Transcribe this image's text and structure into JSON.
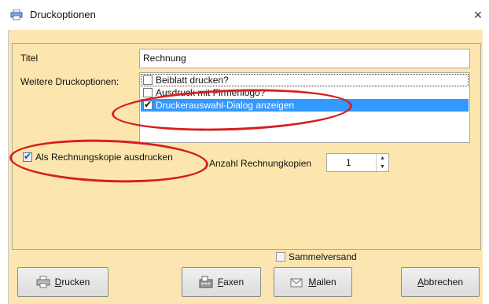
{
  "window": {
    "title": "Druckoptionen",
    "close_glyph": "×"
  },
  "form": {
    "titel_label": "Titel",
    "titel_value": "Rechnung",
    "weitere_label": "Weitere Druckoptionen:",
    "options": [
      {
        "label": "Beiblatt drucken?",
        "checked": false,
        "selected": false
      },
      {
        "label": "Ausdruck mit Firmenlogo?",
        "checked": false,
        "selected": false
      },
      {
        "label": "Druckerauswahl-Dialog anzeigen",
        "checked": true,
        "selected": true
      }
    ],
    "kopie_label": "Als Rechnungskopie ausdrucken",
    "kopie_checked": true,
    "anzahl_label": "Anzahl Rechnungkopien",
    "anzahl_value": "1",
    "sammel_label": "Sammelversand",
    "sammel_checked": false
  },
  "buttons": {
    "drucken_first": "D",
    "drucken_rest": "rucken",
    "faxen_first": "F",
    "faxen_rest": "axen",
    "mailen_first": "M",
    "mailen_rest": "ailen",
    "abbrechen_first": "A",
    "abbrechen_rest": "bbrechen"
  },
  "annotation_color": "#d6201f",
  "icons": [
    "printer-icon",
    "fax-icon",
    "mail-icon",
    "close-icon",
    "checkmark-icon",
    "spin-up-icon",
    "spin-down-icon"
  ]
}
